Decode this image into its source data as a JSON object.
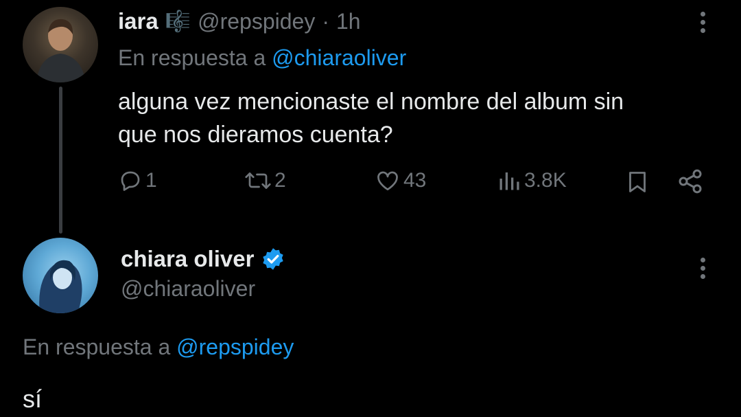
{
  "reply_tweet": {
    "display_name": "iara",
    "name_emoji": "🎼",
    "handle": "@repspidey",
    "separator": "·",
    "time": "1h",
    "in_reply_to_prefix": "En respuesta a",
    "in_reply_to_handle": "@chiaraoliver",
    "text_line1": "alguna vez mencionaste el nombre del album sin",
    "text_line2": "que nos dieramos cuenta?",
    "actions": {
      "replies": "1",
      "retweets": "2",
      "likes": "43",
      "views": "3.8K"
    }
  },
  "main_tweet": {
    "display_name": "chiara oliver",
    "verified": true,
    "handle": "@chiaraoliver",
    "in_reply_to_prefix": "En respuesta a",
    "in_reply_to_handle": "@repspidey",
    "text": "sí"
  },
  "colors": {
    "background": "#000000",
    "text": "#e7e9ea",
    "muted": "#71767b",
    "link": "#1d9bf0",
    "verified": "#1d9bf0"
  }
}
